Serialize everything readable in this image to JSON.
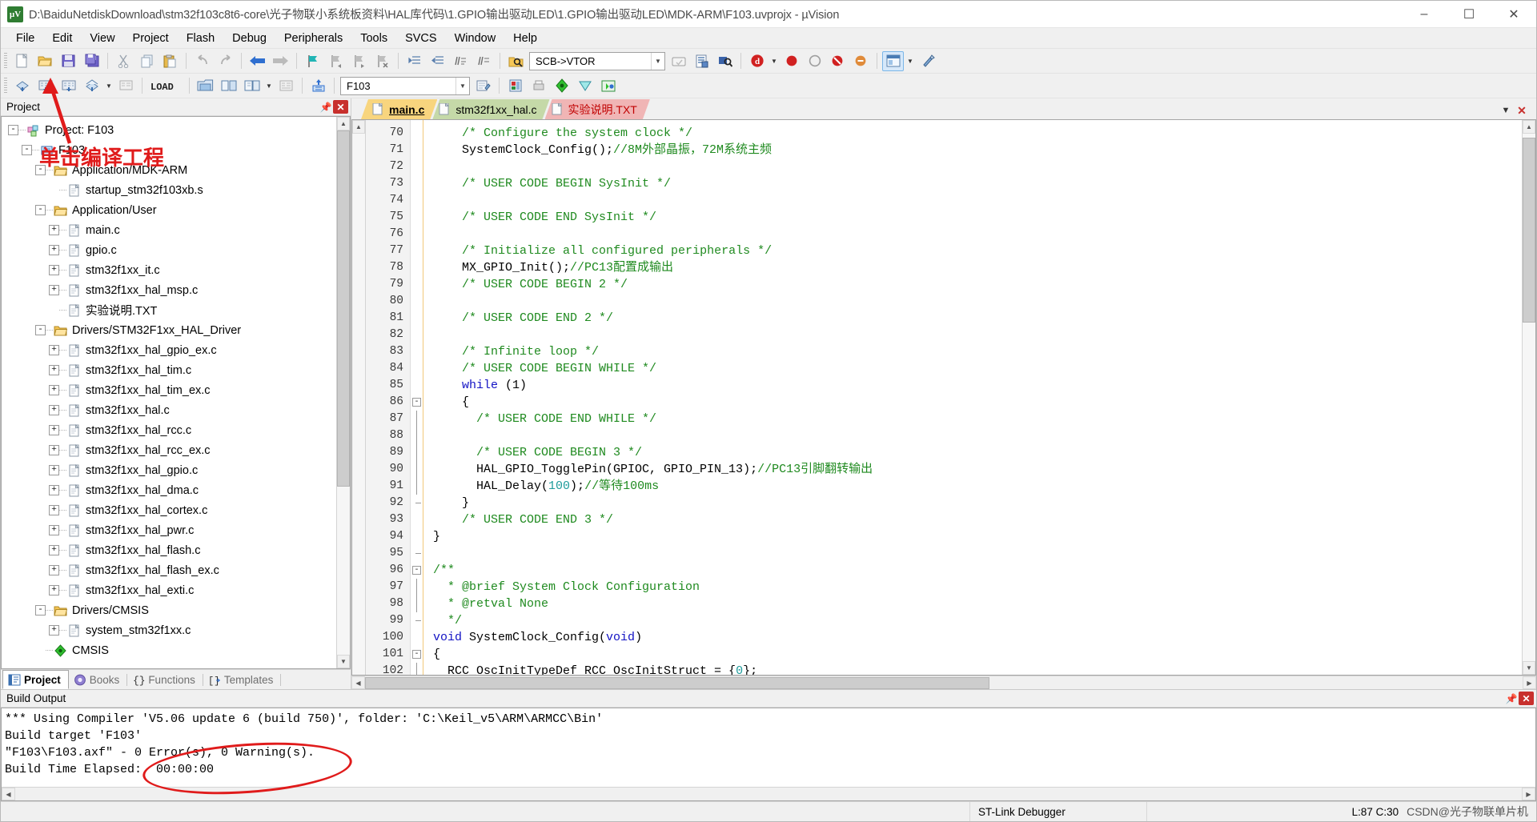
{
  "window": {
    "title": "D:\\BaiduNetdiskDownload\\stm32f103c8t6-core\\光子物联小系统板资料\\HAL库代码\\1.GPIO输出驱动LED\\1.GPIO输出驱动LED\\MDK-ARM\\F103.uvprojx - µVision",
    "app_icon": "uvision-icon",
    "minimize": "–",
    "maximize": "☐",
    "close": "✕"
  },
  "menu": {
    "items": [
      {
        "label": "File"
      },
      {
        "label": "Edit"
      },
      {
        "label": "View"
      },
      {
        "label": "Project"
      },
      {
        "label": "Flash"
      },
      {
        "label": "Debug"
      },
      {
        "label": "Peripherals"
      },
      {
        "label": "Tools"
      },
      {
        "label": "SVCS"
      },
      {
        "label": "Window"
      },
      {
        "label": "Help"
      }
    ]
  },
  "toolbar1": {
    "vtor_value": "SCB->VTOR",
    "icons": [
      "new-file-icon",
      "open-file-icon",
      "save-icon",
      "save-all-icon",
      "cut-icon",
      "copy-icon",
      "paste-icon",
      "undo-icon",
      "redo-icon",
      "navigate-back-icon",
      "navigate-forward-icon",
      "bookmark-toggle-icon",
      "bookmark-prev-icon",
      "bookmark-next-icon",
      "bookmark-clear-icon",
      "indent-icon",
      "outdent-icon",
      "comment-icon",
      "uncomment-icon",
      "find-in-files-icon",
      "insert-watch-icon",
      "config-wizard-icon",
      "find-icon",
      "debug-start-icon",
      "breakpoint-icon",
      "disable-breakpoint-icon",
      "kill-breakpoints-icon",
      "window-layout-icon",
      "options-icon"
    ]
  },
  "toolbar2": {
    "target_value": "F103",
    "load_label": "LOAD",
    "icons": [
      "translate-icon",
      "build-icon",
      "rebuild-icon",
      "batch-build-icon",
      "stop-build-icon",
      "download-icon",
      "target-options-icon",
      "manage-runtime-icon",
      "pack-installer-icon",
      "manage-project-icon",
      "multi-project-icon",
      "pack-icon"
    ]
  },
  "project_panel": {
    "title": "Project",
    "pin_icon": "pin-icon",
    "close_icon": "close-icon",
    "tree": [
      {
        "label": "Project: F103",
        "indent": 0,
        "expander": "-",
        "icon": "project-icon"
      },
      {
        "label": "F103",
        "indent": 1,
        "expander": "-",
        "icon": "target-icon"
      },
      {
        "label": "Application/MDK-ARM",
        "indent": 2,
        "expander": "-",
        "icon": "folder-icon"
      },
      {
        "label": "startup_stm32f103xb.s",
        "indent": 3,
        "expander": "",
        "icon": "file-icon"
      },
      {
        "label": "Application/User",
        "indent": 2,
        "expander": "-",
        "icon": "folder-icon"
      },
      {
        "label": "main.c",
        "indent": 3,
        "expander": "+",
        "icon": "file-icon"
      },
      {
        "label": "gpio.c",
        "indent": 3,
        "expander": "+",
        "icon": "file-icon"
      },
      {
        "label": "stm32f1xx_it.c",
        "indent": 3,
        "expander": "+",
        "icon": "file-icon"
      },
      {
        "label": "stm32f1xx_hal_msp.c",
        "indent": 3,
        "expander": "+",
        "icon": "file-icon"
      },
      {
        "label": "实验说明.TXT",
        "indent": 3,
        "expander": "",
        "icon": "file-icon"
      },
      {
        "label": "Drivers/STM32F1xx_HAL_Driver",
        "indent": 2,
        "expander": "-",
        "icon": "folder-icon"
      },
      {
        "label": "stm32f1xx_hal_gpio_ex.c",
        "indent": 3,
        "expander": "+",
        "icon": "file-icon"
      },
      {
        "label": "stm32f1xx_hal_tim.c",
        "indent": 3,
        "expander": "+",
        "icon": "file-icon"
      },
      {
        "label": "stm32f1xx_hal_tim_ex.c",
        "indent": 3,
        "expander": "+",
        "icon": "file-icon"
      },
      {
        "label": "stm32f1xx_hal.c",
        "indent": 3,
        "expander": "+",
        "icon": "file-icon"
      },
      {
        "label": "stm32f1xx_hal_rcc.c",
        "indent": 3,
        "expander": "+",
        "icon": "file-icon"
      },
      {
        "label": "stm32f1xx_hal_rcc_ex.c",
        "indent": 3,
        "expander": "+",
        "icon": "file-icon"
      },
      {
        "label": "stm32f1xx_hal_gpio.c",
        "indent": 3,
        "expander": "+",
        "icon": "file-icon"
      },
      {
        "label": "stm32f1xx_hal_dma.c",
        "indent": 3,
        "expander": "+",
        "icon": "file-icon"
      },
      {
        "label": "stm32f1xx_hal_cortex.c",
        "indent": 3,
        "expander": "+",
        "icon": "file-icon"
      },
      {
        "label": "stm32f1xx_hal_pwr.c",
        "indent": 3,
        "expander": "+",
        "icon": "file-icon"
      },
      {
        "label": "stm32f1xx_hal_flash.c",
        "indent": 3,
        "expander": "+",
        "icon": "file-icon"
      },
      {
        "label": "stm32f1xx_hal_flash_ex.c",
        "indent": 3,
        "expander": "+",
        "icon": "file-icon"
      },
      {
        "label": "stm32f1xx_hal_exti.c",
        "indent": 3,
        "expander": "+",
        "icon": "file-icon"
      },
      {
        "label": "Drivers/CMSIS",
        "indent": 2,
        "expander": "-",
        "icon": "folder-icon"
      },
      {
        "label": "system_stm32f1xx.c",
        "indent": 3,
        "expander": "+",
        "icon": "file-icon"
      },
      {
        "label": "CMSIS",
        "indent": 2,
        "expander": "",
        "icon": "cmsis-icon"
      }
    ],
    "tabs": [
      {
        "label": "Project",
        "icon": "project-tab-icon",
        "active": true
      },
      {
        "label": "Books",
        "icon": "books-tab-icon",
        "active": false
      },
      {
        "label": "Functions",
        "icon": "functions-tab-icon",
        "active": false
      },
      {
        "label": "Templates",
        "icon": "templates-tab-icon",
        "active": false
      }
    ]
  },
  "annotation": {
    "text": "单击编译工程",
    "color": "#e01b1b",
    "arrow_icon": "red-arrow-icon",
    "ellipse_color": "#e01b1b"
  },
  "editor": {
    "tabs": [
      {
        "label": "main.c",
        "icon": "file-icon",
        "active": true
      },
      {
        "label": "stm32f1xx_hal.c",
        "icon": "file-icon",
        "active": false
      },
      {
        "label": "实验说明.TXT",
        "icon": "file-icon",
        "active": false
      }
    ],
    "tab_list_icon": "tab-list-icon",
    "tab_close_icon": "close-icon",
    "first_line": 70,
    "lines": [
      {
        "n": 70,
        "fold": "",
        "tokens": [
          {
            "t": "    ",
            "c": "c-txt"
          },
          {
            "t": "/* Configure the system clock */",
            "c": "c-com"
          }
        ]
      },
      {
        "n": 71,
        "fold": "",
        "tokens": [
          {
            "t": "    SystemClock_Config();",
            "c": "c-txt"
          },
          {
            "t": "//8M外部晶振，72M系统主频",
            "c": "c-com"
          }
        ]
      },
      {
        "n": 72,
        "fold": "",
        "tokens": []
      },
      {
        "n": 73,
        "fold": "",
        "tokens": [
          {
            "t": "    ",
            "c": "c-txt"
          },
          {
            "t": "/* USER CODE BEGIN SysInit */",
            "c": "c-com"
          }
        ]
      },
      {
        "n": 74,
        "fold": "",
        "tokens": []
      },
      {
        "n": 75,
        "fold": "",
        "tokens": [
          {
            "t": "    ",
            "c": "c-txt"
          },
          {
            "t": "/* USER CODE END SysInit */",
            "c": "c-com"
          }
        ]
      },
      {
        "n": 76,
        "fold": "",
        "tokens": []
      },
      {
        "n": 77,
        "fold": "",
        "tokens": [
          {
            "t": "    ",
            "c": "c-txt"
          },
          {
            "t": "/* Initialize all configured peripherals */",
            "c": "c-com"
          }
        ]
      },
      {
        "n": 78,
        "fold": "",
        "tokens": [
          {
            "t": "    MX_GPIO_Init();",
            "c": "c-txt"
          },
          {
            "t": "//PC13配置成输出",
            "c": "c-com"
          }
        ]
      },
      {
        "n": 79,
        "fold": "",
        "tokens": [
          {
            "t": "    ",
            "c": "c-txt"
          },
          {
            "t": "/* USER CODE BEGIN 2 */",
            "c": "c-com"
          }
        ]
      },
      {
        "n": 80,
        "fold": "",
        "tokens": []
      },
      {
        "n": 81,
        "fold": "",
        "tokens": [
          {
            "t": "    ",
            "c": "c-txt"
          },
          {
            "t": "/* USER CODE END 2 */",
            "c": "c-com"
          }
        ]
      },
      {
        "n": 82,
        "fold": "",
        "tokens": []
      },
      {
        "n": 83,
        "fold": "",
        "tokens": [
          {
            "t": "    ",
            "c": "c-txt"
          },
          {
            "t": "/* Infinite loop */",
            "c": "c-com"
          }
        ]
      },
      {
        "n": 84,
        "fold": "",
        "tokens": [
          {
            "t": "    ",
            "c": "c-txt"
          },
          {
            "t": "/* USER CODE BEGIN WHILE */",
            "c": "c-com"
          }
        ]
      },
      {
        "n": 85,
        "fold": "",
        "tokens": [
          {
            "t": "    ",
            "c": "c-txt"
          },
          {
            "t": "while",
            "c": "c-kw"
          },
          {
            "t": " (1)",
            "c": "c-txt"
          }
        ]
      },
      {
        "n": 86,
        "fold": "-",
        "tokens": [
          {
            "t": "    {",
            "c": "c-txt"
          }
        ]
      },
      {
        "n": 87,
        "fold": "|",
        "tokens": [
          {
            "t": "      ",
            "c": "c-txt"
          },
          {
            "t": "/* USER CODE END WHILE */",
            "c": "c-com"
          }
        ]
      },
      {
        "n": 88,
        "fold": "|",
        "tokens": []
      },
      {
        "n": 89,
        "fold": "|",
        "tokens": [
          {
            "t": "      ",
            "c": "c-txt"
          },
          {
            "t": "/* USER CODE BEGIN 3 */",
            "c": "c-com"
          }
        ]
      },
      {
        "n": 90,
        "fold": "|",
        "tokens": [
          {
            "t": "      HAL_GPIO_TogglePin(GPIOC, GPIO_PIN_13);",
            "c": "c-txt"
          },
          {
            "t": "//PC13引脚翻转输出",
            "c": "c-com"
          }
        ]
      },
      {
        "n": 91,
        "fold": "|",
        "tokens": [
          {
            "t": "      HAL_Delay(",
            "c": "c-txt"
          },
          {
            "t": "100",
            "c": "c-num"
          },
          {
            "t": ");",
            "c": "c-txt"
          },
          {
            "t": "//等待100ms",
            "c": "c-com"
          }
        ]
      },
      {
        "n": 92,
        "fold": "L",
        "tokens": [
          {
            "t": "    }",
            "c": "c-txt"
          }
        ]
      },
      {
        "n": 93,
        "fold": "",
        "tokens": [
          {
            "t": "    ",
            "c": "c-txt"
          },
          {
            "t": "/* USER CODE END 3 */",
            "c": "c-com"
          }
        ]
      },
      {
        "n": 94,
        "fold": "",
        "tokens": [
          {
            "t": "}",
            "c": "c-txt"
          }
        ]
      },
      {
        "n": 95,
        "fold": "L",
        "tokens": []
      },
      {
        "n": 96,
        "fold": "-",
        "tokens": [
          {
            "t": "/**",
            "c": "c-com"
          }
        ]
      },
      {
        "n": 97,
        "fold": "|",
        "tokens": [
          {
            "t": "  * @brief System Clock Configuration",
            "c": "c-com"
          }
        ]
      },
      {
        "n": 98,
        "fold": "|",
        "tokens": [
          {
            "t": "  * @retval None",
            "c": "c-com"
          }
        ]
      },
      {
        "n": 99,
        "fold": "L",
        "tokens": [
          {
            "t": "  */",
            "c": "c-com"
          }
        ]
      },
      {
        "n": 100,
        "fold": "",
        "tokens": [
          {
            "t": "void",
            "c": "c-kw"
          },
          {
            "t": " SystemClock_Config(",
            "c": "c-txt"
          },
          {
            "t": "void",
            "c": "c-kw"
          },
          {
            "t": ")",
            "c": "c-txt"
          }
        ]
      },
      {
        "n": 101,
        "fold": "-",
        "tokens": [
          {
            "t": "{",
            "c": "c-txt"
          }
        ]
      },
      {
        "n": 102,
        "fold": "|",
        "tokens": [
          {
            "t": "  RCC_OscInitTypeDef RCC_OscInitStruct = {",
            "c": "c-txt"
          },
          {
            "t": "0",
            "c": "c-num"
          },
          {
            "t": "};",
            "c": "c-txt"
          }
        ]
      }
    ]
  },
  "build_output": {
    "title": "Build Output",
    "pin_icon": "pin-icon",
    "close_icon": "close-icon",
    "lines": [
      "*** Using Compiler 'V5.06 update 6 (build 750)', folder: 'C:\\Keil_v5\\ARM\\ARMCC\\Bin'",
      "Build target 'F103'",
      "\"F103\\F103.axf\" - 0 Error(s), 0 Warning(s).",
      "Build Time Elapsed:  00:00:00"
    ]
  },
  "statusbar": {
    "debugger": "ST-Link Debugger",
    "position": "L:87 C:30",
    "watermark": "CSDN@光子物联单片机"
  }
}
